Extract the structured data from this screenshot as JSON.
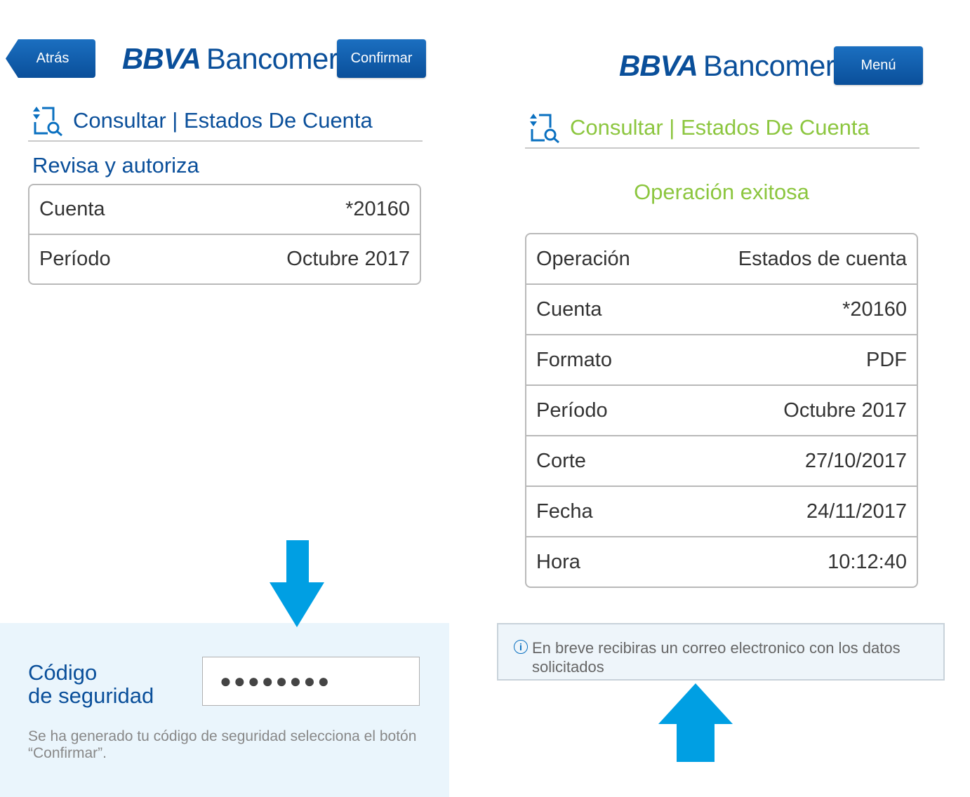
{
  "left": {
    "back_label": "Atrás",
    "logo_bold": "BBVA",
    "logo_light": "Bancomer",
    "confirm_label": "Confirmar",
    "section_title": "Consultar | Estados De Cuenta",
    "subtitle": "Revisa y autoriza",
    "rows": [
      {
        "label": "Cuenta",
        "value": "*20160"
      },
      {
        "label": "Período",
        "value": "Octubre 2017"
      }
    ],
    "code_label_line1": "Código",
    "code_label_line2": "de seguridad",
    "code_value": "●●●●●●●●",
    "note": "Se ha generado tu código de seguridad selecciona el botón “Confirmar”."
  },
  "right": {
    "logo_bold": "BBVA",
    "logo_light": "Bancomer",
    "menu_label": "Menú",
    "section_title": "Consultar | Estados De Cuenta",
    "success": "Operación exitosa",
    "rows": [
      {
        "label": "Operación",
        "value": "Estados de cuenta"
      },
      {
        "label": "Cuenta",
        "value": "*20160"
      },
      {
        "label": "Formato",
        "value": "PDF"
      },
      {
        "label": "Período",
        "value": "Octubre 2017"
      },
      {
        "label": "Corte",
        "value": "27/10/2017"
      },
      {
        "label": "Fecha",
        "value": "24/11/2017"
      },
      {
        "label": "Hora",
        "value": "10:12:40"
      }
    ],
    "info": "En breve recibiras un correo electronico con los datos solicitados"
  },
  "colors": {
    "brand_blue": "#0a4f9a",
    "success_green": "#8cc63f",
    "arrow_blue": "#009fe3"
  },
  "icons": {
    "section": "document-search-icon",
    "arrow_down": "arrow-down-icon",
    "arrow_up": "arrow-up-icon",
    "info": "info-icon"
  }
}
